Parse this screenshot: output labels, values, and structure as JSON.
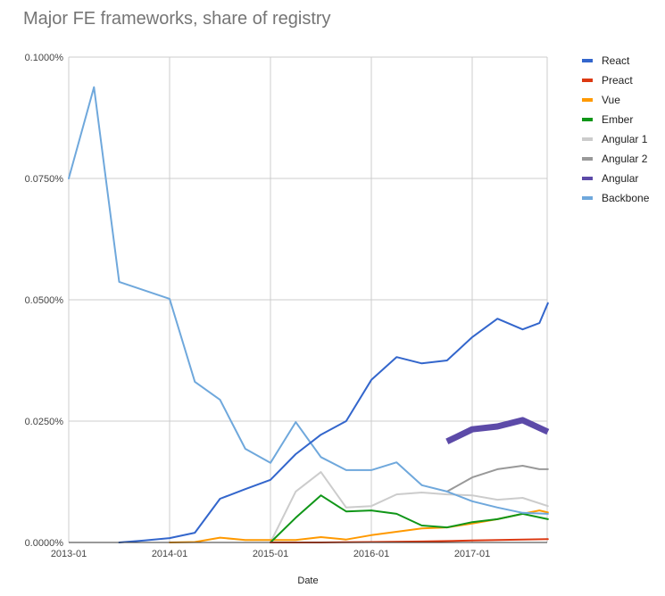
{
  "title": "Major FE frameworks, share of registry",
  "chart_data": {
    "type": "line",
    "title": "Major FE frameworks, share of registry",
    "xlabel": "Date",
    "ylabel": "",
    "x_tick_labels": [
      "2013-01",
      "2014-01",
      "2015-01",
      "2016-01",
      "2017-01"
    ],
    "y_tick_labels": [
      "0.0000%",
      "0.0250%",
      "0.0500%",
      "0.0750%",
      "0.1000%"
    ],
    "y_ticks": [
      0,
      0.025,
      0.05,
      0.075,
      0.1
    ],
    "ylim": [
      0,
      0.1
    ],
    "xlim": [
      "2013-01",
      "2017-10"
    ],
    "y_unit": "%",
    "grid": true,
    "legend_position": "right",
    "series": [
      {
        "name": "React",
        "color": "#3366cc",
        "width": 2,
        "x": [
          "2013-07",
          "2013-10",
          "2014-01",
          "2014-04",
          "2014-07",
          "2014-10",
          "2015-01",
          "2015-04",
          "2015-07",
          "2015-10",
          "2016-01",
          "2016-04",
          "2016-07",
          "2016-10",
          "2017-01",
          "2017-04",
          "2017-07",
          "2017-09",
          "2017-10"
        ],
        "values": [
          0.0,
          0.0004,
          0.0009,
          0.002,
          0.009,
          0.011,
          0.0129,
          0.0182,
          0.0222,
          0.025,
          0.0335,
          0.0382,
          0.0369,
          0.0375,
          0.0423,
          0.0461,
          0.0439,
          0.0452,
          0.0493
        ]
      },
      {
        "name": "Preact",
        "color": "#dc3912",
        "width": 2,
        "x": [
          "2015-01",
          "2015-07",
          "2016-01",
          "2016-07",
          "2017-01",
          "2017-07",
          "2017-10"
        ],
        "values": [
          0.0,
          0.0,
          0.0001,
          0.0002,
          0.0004,
          0.0006,
          0.0007
        ]
      },
      {
        "name": "Vue",
        "color": "#ff9900",
        "width": 2,
        "x": [
          "2014-01",
          "2014-04",
          "2014-07",
          "2014-10",
          "2015-01",
          "2015-04",
          "2015-07",
          "2015-10",
          "2016-01",
          "2016-04",
          "2016-07",
          "2016-10",
          "2017-01",
          "2017-04",
          "2017-07",
          "2017-09",
          "2017-10"
        ],
        "values": [
          0.0,
          0.0001,
          0.001,
          0.0005,
          0.0005,
          0.0005,
          0.0011,
          0.0006,
          0.0015,
          0.0022,
          0.0029,
          0.0031,
          0.0039,
          0.0048,
          0.0059,
          0.0066,
          0.0062
        ]
      },
      {
        "name": "Ember",
        "color": "#109618",
        "width": 2,
        "x": [
          "2015-01",
          "2015-04",
          "2015-07",
          "2015-10",
          "2016-01",
          "2016-04",
          "2016-07",
          "2016-10",
          "2017-01",
          "2017-04",
          "2017-07",
          "2017-10"
        ],
        "values": [
          0.0,
          0.0051,
          0.0097,
          0.0064,
          0.0066,
          0.0059,
          0.0035,
          0.0031,
          0.0042,
          0.0048,
          0.0059,
          0.0048
        ]
      },
      {
        "name": "Angular 1",
        "color": "#cccccc",
        "width": 2,
        "x": [
          "2015-01",
          "2015-04",
          "2015-07",
          "2015-10",
          "2016-01",
          "2016-04",
          "2016-07",
          "2016-10",
          "2017-01",
          "2017-04",
          "2017-07",
          "2017-10"
        ],
        "values": [
          0.0,
          0.0105,
          0.0145,
          0.0072,
          0.0075,
          0.0099,
          0.0103,
          0.0099,
          0.0097,
          0.0088,
          0.0092,
          0.0075
        ]
      },
      {
        "name": "Angular 2",
        "color": "#999999",
        "width": 2,
        "x": [
          "2016-10",
          "2017-01",
          "2017-04",
          "2017-07",
          "2017-09",
          "2017-10"
        ],
        "values": [
          0.0105,
          0.0134,
          0.0151,
          0.0158,
          0.0151,
          0.0151
        ]
      },
      {
        "name": "Angular",
        "color": "#5c4aa8",
        "width": 7,
        "x": [
          "2016-10",
          "2017-01",
          "2017-04",
          "2017-07",
          "2017-10"
        ],
        "values": [
          0.0208,
          0.0233,
          0.0239,
          0.0252,
          0.0228
        ]
      },
      {
        "name": "Backbone",
        "color": "#6fa8dc",
        "width": 2,
        "x": [
          "2013-01",
          "2013-04",
          "2013-07",
          "2014-01",
          "2014-04",
          "2014-07",
          "2014-10",
          "2015-01",
          "2015-04",
          "2015-07",
          "2015-10",
          "2016-01",
          "2016-04",
          "2016-07",
          "2016-10",
          "2017-01",
          "2017-04",
          "2017-07",
          "2017-10"
        ],
        "values": [
          0.075,
          0.0938,
          0.0537,
          0.0502,
          0.0331,
          0.0294,
          0.0193,
          0.0164,
          0.0248,
          0.0176,
          0.0149,
          0.0149,
          0.0165,
          0.0118,
          0.0105,
          0.0085,
          0.0072,
          0.0061,
          0.0059
        ]
      }
    ]
  }
}
